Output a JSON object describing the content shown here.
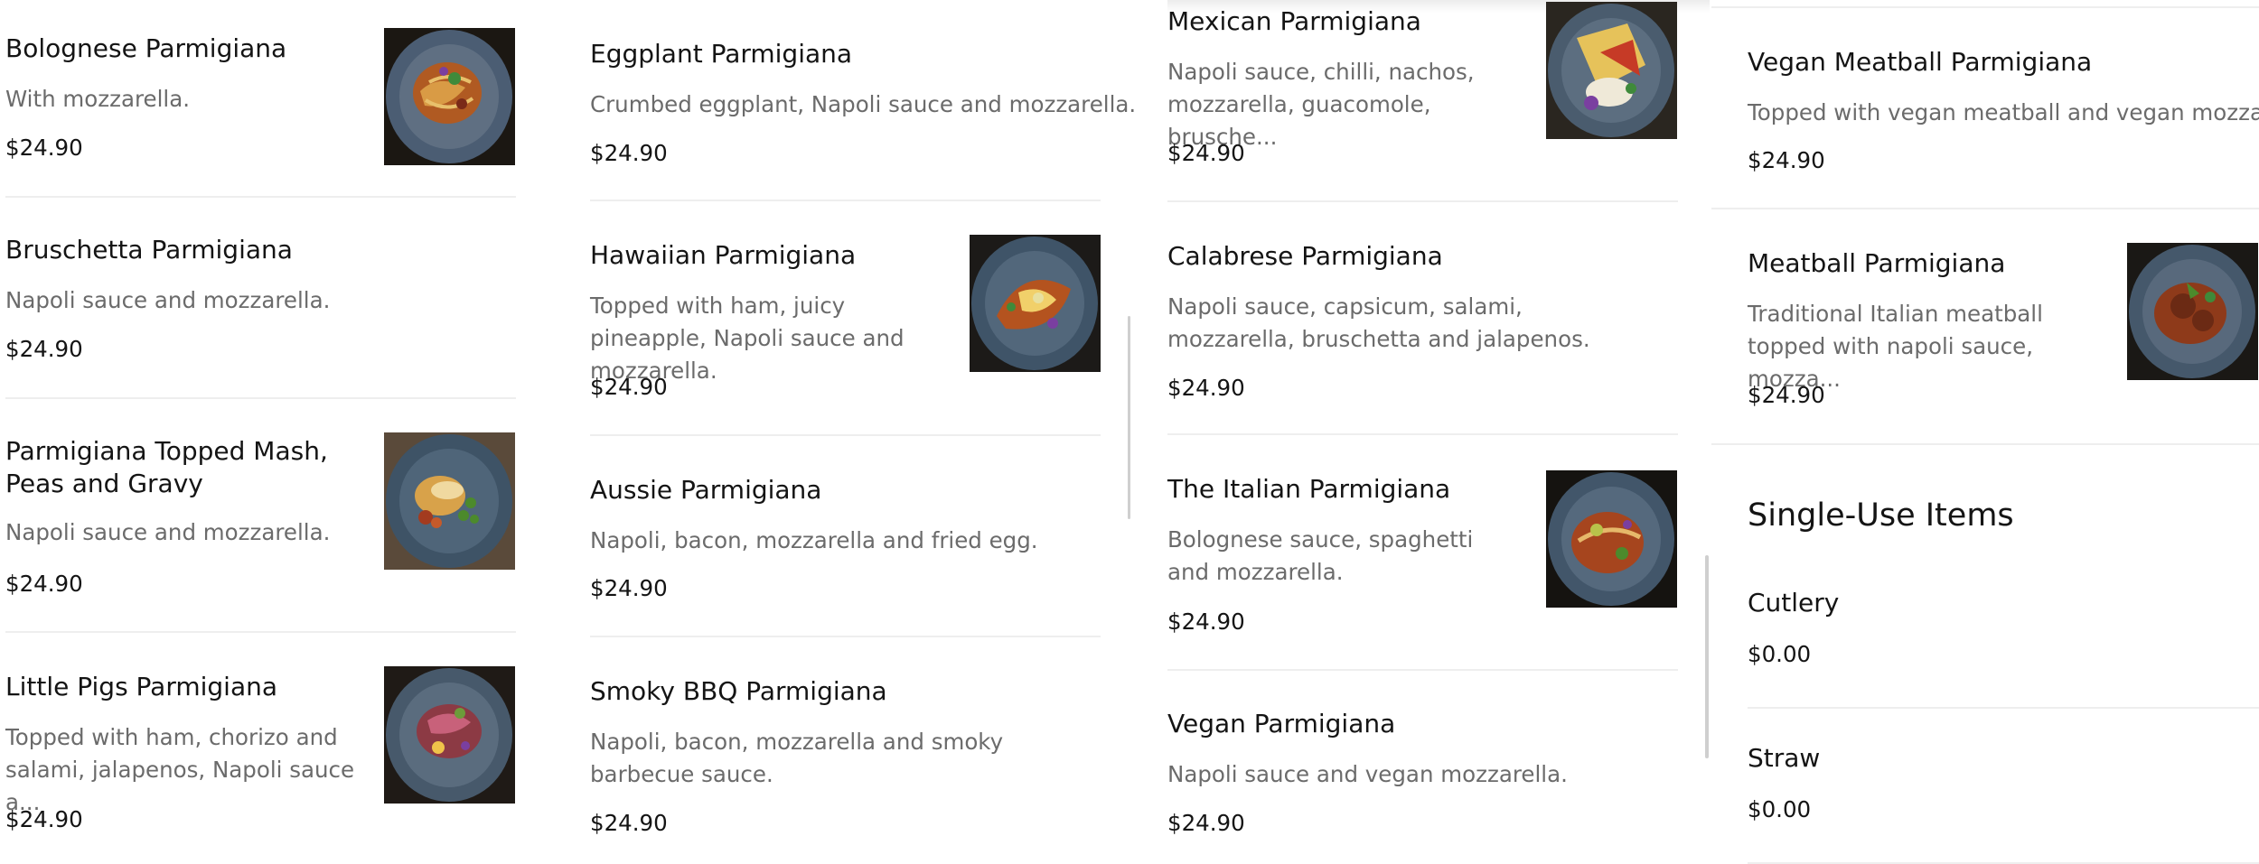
{
  "columns": [
    {
      "items": [
        {
          "name": "Bolognese Parmigiana",
          "desc": "With mozzarella.",
          "price": "$24.90",
          "image": "bolognese-dish"
        },
        {
          "name": "Bruschetta Parmigiana",
          "desc": "Napoli sauce and mozzarella.",
          "price": "$24.90"
        },
        {
          "name": "Parmigiana Topped Mash, Peas and Gravy",
          "desc": "Napoli sauce and mozzarella.",
          "price": "$24.90",
          "image": "mash-peas-dish"
        },
        {
          "name": "Little Pigs Parmigiana",
          "desc": "Topped with ham, chorizo and salami, jalapenos, Napoli sauce a...",
          "price": "$24.90",
          "image": "little-pigs-dish"
        }
      ]
    },
    {
      "items": [
        {
          "name": "Eggplant Parmigiana",
          "desc": "Crumbed eggplant, Napoli sauce and mozzarella.",
          "price": "$24.90"
        },
        {
          "name": "Hawaiian Parmigiana",
          "desc": "Topped with ham, juicy pineapple, Napoli sauce and mozzarella.",
          "price": "$24.90",
          "image": "hawaiian-dish"
        },
        {
          "name": "Aussie Parmigiana",
          "desc": "Napoli, bacon, mozzarella and fried egg.",
          "price": "$24.90"
        },
        {
          "name": "Smoky BBQ Parmigiana",
          "desc": "Napoli, bacon, mozzarella and smoky barbecue sauce.",
          "price": "$24.90"
        }
      ]
    },
    {
      "items": [
        {
          "name": "Mexican Parmigiana",
          "desc": "Napoli sauce, chilli, nachos, mozzarella, guacomole, brusche...",
          "price": "$24.90",
          "image": "mexican-dish"
        },
        {
          "name": "Calabrese Parmigiana",
          "desc": "Napoli sauce, capsicum, salami, mozzarella, bruschetta and jalapenos.",
          "price": "$24.90"
        },
        {
          "name": "The Italian Parmigiana",
          "desc": "Bolognese sauce, spaghetti and mozzarella.",
          "price": "$24.90",
          "image": "italian-dish"
        },
        {
          "name": "Vegan Parmigiana",
          "desc": "Napoli sauce and vegan mozzarella.",
          "price": "$24.90"
        }
      ]
    },
    {
      "items": [
        {
          "name": "Vegan Meatball Parmigiana",
          "desc": "Topped with vegan meatball and vegan mozzarella.",
          "price": "$24.90"
        },
        {
          "name": "Meatball Parmigiana",
          "desc": "Traditional Italian meatball topped with napoli sauce, mozza...",
          "price": "$24.90",
          "image": "meatball-dish"
        }
      ],
      "section": {
        "title": "Single-Use Items",
        "items": [
          {
            "name": "Cutlery",
            "price": "$0.00"
          },
          {
            "name": "Straw",
            "price": "$0.00"
          }
        ]
      }
    }
  ]
}
